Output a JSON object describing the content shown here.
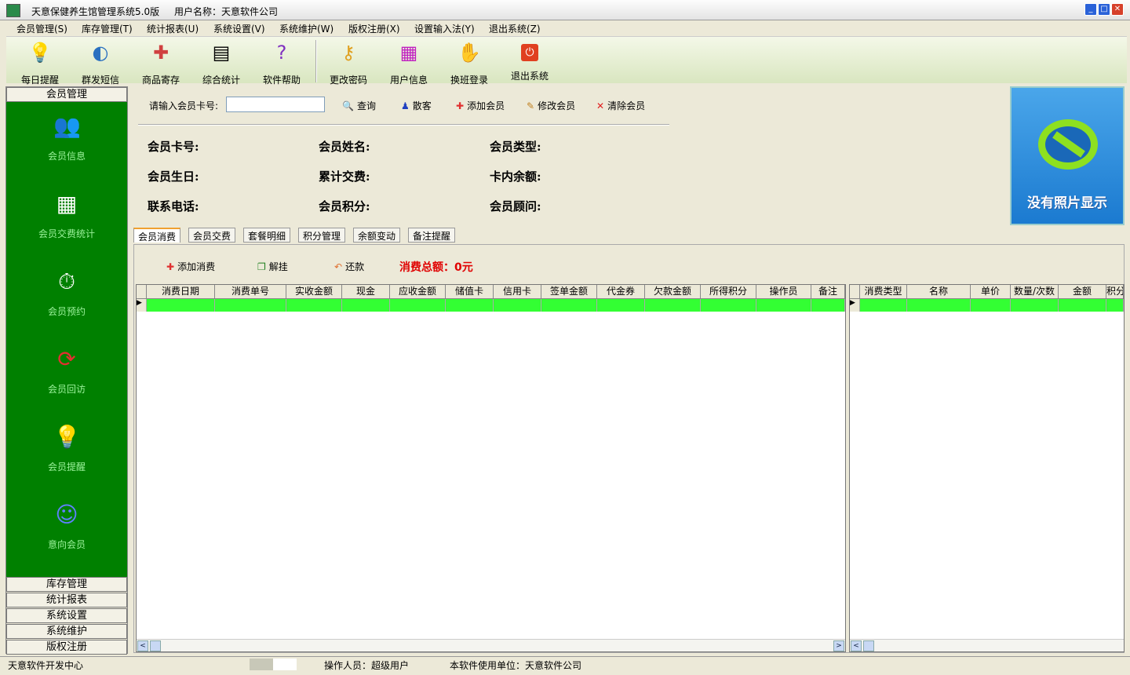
{
  "window": {
    "title": "天意保健养生馆管理系统5.0版",
    "user": "用户名称：天意软件公司"
  },
  "menu": [
    "会员管理(S)",
    "库存管理(T)",
    "统计报表(U)",
    "系统设置(V)",
    "系统维护(W)",
    "版权注册(X)",
    "设置输入法(Y)",
    "退出系统(Z)"
  ],
  "toolbar": [
    {
      "label": "每日提醒",
      "icon": "bulb-icon"
    },
    {
      "label": "群发短信",
      "icon": "satellite-icon"
    },
    {
      "label": "商品寄存",
      "icon": "gift-icon"
    },
    {
      "label": "综合统计",
      "icon": "book-icon"
    },
    {
      "label": "软件帮助",
      "icon": "help-book-icon"
    },
    {
      "label": "更改密码",
      "icon": "key-icon"
    },
    {
      "label": "用户信息",
      "icon": "books-icon"
    },
    {
      "label": "换班登录",
      "icon": "handshake-icon"
    },
    {
      "label": "退出系统",
      "icon": "power-icon"
    }
  ],
  "sidebar": {
    "header": "会员管理",
    "items": [
      "会员信息",
      "会员交费统计",
      "会员预约",
      "会员回访",
      "会员提醒",
      "意向会员"
    ],
    "sections": [
      "库存管理",
      "统计报表",
      "系统设置",
      "系统维护",
      "版权注册"
    ]
  },
  "search": {
    "label": "请输入会员卡号:",
    "value": "",
    "query": "查询",
    "guest": "散客",
    "add": "添加会员",
    "edit": "修改会员",
    "clear": "清除会员"
  },
  "fields": [
    "会员卡号:",
    "会员姓名:",
    "会员类型:",
    "会员生日:",
    "累计交费:",
    "卡内余额:",
    "联系电话:",
    "会员积分:",
    "会员顾问:"
  ],
  "photo": "没有照片显示",
  "tabs": [
    "会员消费",
    "会员交费",
    "套餐明细",
    "积分管理",
    "余额变动",
    "备注提醒"
  ],
  "consume": {
    "add": "添加消费",
    "unhang": "解挂",
    "repay": "还款",
    "total": "消费总额：0元"
  },
  "grid_left": [
    "消费日期",
    "消费单号",
    "实收金额",
    "现金",
    "应收金额",
    "储值卡",
    "信用卡",
    "签单金额",
    "代金券",
    "欠款金额",
    "所得积分",
    "操作员",
    "备注"
  ],
  "grid_right": [
    "消费类型",
    "名称",
    "单价",
    "数量/次数",
    "金额",
    "积分"
  ],
  "status": {
    "dev": "天意软件开发中心",
    "operator": "操作人员：超级用户",
    "unit": "本软件使用单位：天意软件公司"
  }
}
